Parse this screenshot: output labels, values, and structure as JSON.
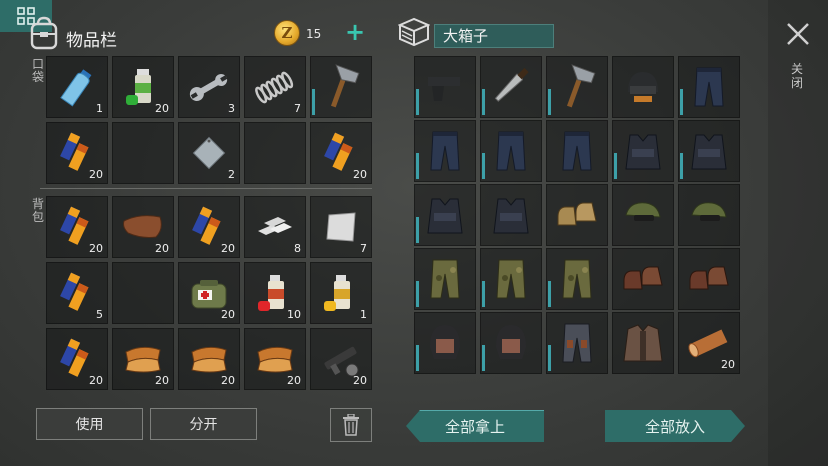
{
  "inventory": {
    "title": "物品栏",
    "coin_symbol": "Z",
    "coins": "15",
    "add_label": "+",
    "pocket_label": "口袋",
    "backpack_label": "背包",
    "pocket_slots": [
      {
        "icon": "water-bottle-icon",
        "count": "1"
      },
      {
        "icon": "spray-can-green-icon",
        "count": "20"
      },
      {
        "icon": "wrench-icon",
        "count": "3"
      },
      {
        "icon": "spring-icon",
        "count": "7"
      },
      {
        "icon": "hatchet-icon",
        "count": ""
      },
      {
        "icon": "batteries-icon",
        "count": "20"
      },
      {
        "icon": "empty",
        "count": ""
      },
      {
        "icon": "metal-plate-icon",
        "count": "2"
      },
      {
        "icon": "empty",
        "count": ""
      },
      {
        "icon": "batteries-icon",
        "count": "20"
      }
    ],
    "backpack_slots": [
      {
        "icon": "batteries-icon",
        "count": "20"
      },
      {
        "icon": "leather-icon",
        "count": "20"
      },
      {
        "icon": "batteries-icon",
        "count": "20"
      },
      {
        "icon": "metal-bars-icon",
        "count": "8"
      },
      {
        "icon": "metal-sheet-icon",
        "count": "7"
      },
      {
        "icon": "batteries-icon",
        "count": "5"
      },
      {
        "icon": "empty",
        "count": ""
      },
      {
        "icon": "medkit-bag-icon",
        "count": "20"
      },
      {
        "icon": "spray-can-red-icon",
        "count": "10"
      },
      {
        "icon": "spray-can-yellow-icon",
        "count": "1"
      },
      {
        "icon": "batteries-icon",
        "count": "20"
      },
      {
        "icon": "fur-pelt-icon",
        "count": "20"
      },
      {
        "icon": "fur-pelt-icon",
        "count": "20"
      },
      {
        "icon": "fur-pelt-icon",
        "count": "20"
      },
      {
        "icon": "gun-parts-icon",
        "count": "20"
      }
    ],
    "use_label": "使用",
    "split_label": "分开"
  },
  "container": {
    "title": "大箱子",
    "close_label": "关闭",
    "take_all_label": "全部拿上",
    "put_all_label": "全部放入",
    "slots": [
      {
        "icon": "pistol-icon",
        "count": ""
      },
      {
        "icon": "machete-icon",
        "count": ""
      },
      {
        "icon": "hatchet-icon",
        "count": ""
      },
      {
        "icon": "police-helmet-icon",
        "count": ""
      },
      {
        "icon": "police-pants-icon",
        "count": ""
      },
      {
        "icon": "police-pants-icon",
        "count": ""
      },
      {
        "icon": "police-pants-icon",
        "count": ""
      },
      {
        "icon": "police-pants-icon",
        "count": ""
      },
      {
        "icon": "police-vest-icon",
        "count": ""
      },
      {
        "icon": "police-vest-icon",
        "count": ""
      },
      {
        "icon": "police-vest-icon",
        "count": ""
      },
      {
        "icon": "police-vest-icon",
        "count": ""
      },
      {
        "icon": "boots-tan-icon",
        "count": ""
      },
      {
        "icon": "military-cap-icon",
        "count": ""
      },
      {
        "icon": "military-cap-icon",
        "count": ""
      },
      {
        "icon": "camo-pants-icon",
        "count": ""
      },
      {
        "icon": "camo-pants-icon",
        "count": ""
      },
      {
        "icon": "camo-pants-icon",
        "count": ""
      },
      {
        "icon": "boots-brown-icon",
        "count": ""
      },
      {
        "icon": "boots-brown-icon",
        "count": ""
      },
      {
        "icon": "biker-helmet-icon",
        "count": ""
      },
      {
        "icon": "biker-helmet-icon",
        "count": ""
      },
      {
        "icon": "leather-pants-icon",
        "count": ""
      },
      {
        "icon": "leather-jacket-icon",
        "count": ""
      },
      {
        "icon": "wood-log-icon",
        "count": "20"
      }
    ]
  },
  "colors": {
    "accent_teal": "#2e6d68",
    "plus_teal": "#39c6b0",
    "coin_gold": "#e4a82a"
  }
}
